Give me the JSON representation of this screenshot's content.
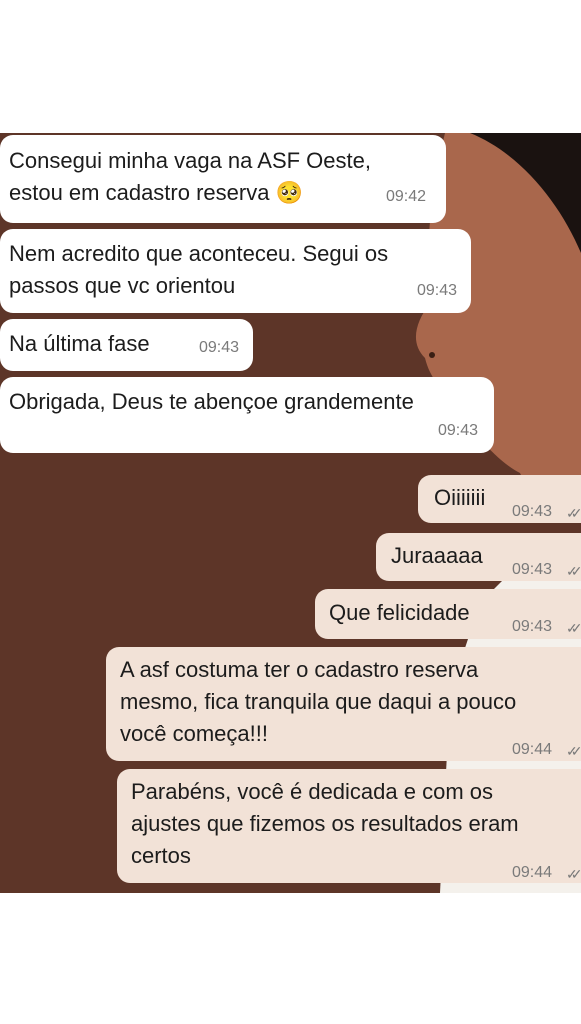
{
  "messages": [
    {
      "dir": "in",
      "text": "Consegui minha vaga na ASF Oeste,\nestou em cadastro reserva 🥺",
      "time": "09:42"
    },
    {
      "dir": "in",
      "text": "Nem acredito que aconteceu. Segui os\npassos que vc orientou",
      "time": "09:43"
    },
    {
      "dir": "in",
      "text": "Na última fase",
      "time": "09:43"
    },
    {
      "dir": "in",
      "text": "Obrigada, Deus te abençoe grandemente",
      "time": "09:43"
    },
    {
      "dir": "out",
      "text": "Oiiiiiii",
      "time": "09:43",
      "status_icon": "double-check-icon"
    },
    {
      "dir": "out",
      "text": "Juraaaaa",
      "time": "09:43",
      "status_icon": "double-check-icon"
    },
    {
      "dir": "out",
      "text": "Que felicidade",
      "time": "09:43",
      "status_icon": "double-check-icon"
    },
    {
      "dir": "out",
      "text": "A asf costuma ter o cadastro reserva\nmesmo, fica tranquila que daqui a pouco\nvocê começa!!!",
      "time": "09:44",
      "status_icon": "double-check-icon"
    },
    {
      "dir": "out",
      "text": "Parabéns, você é dedicada e com os\najustes que fizemos os resultados eram\ncertos",
      "time": "09:44",
      "status_icon": "double-check-icon"
    }
  ],
  "colors": {
    "wallpaper": "#5d3528",
    "incoming_bubble": "#ffffff",
    "outgoing_bubble": "#f2e2d7"
  },
  "wallpaper_image": "woman-profile-portrait"
}
